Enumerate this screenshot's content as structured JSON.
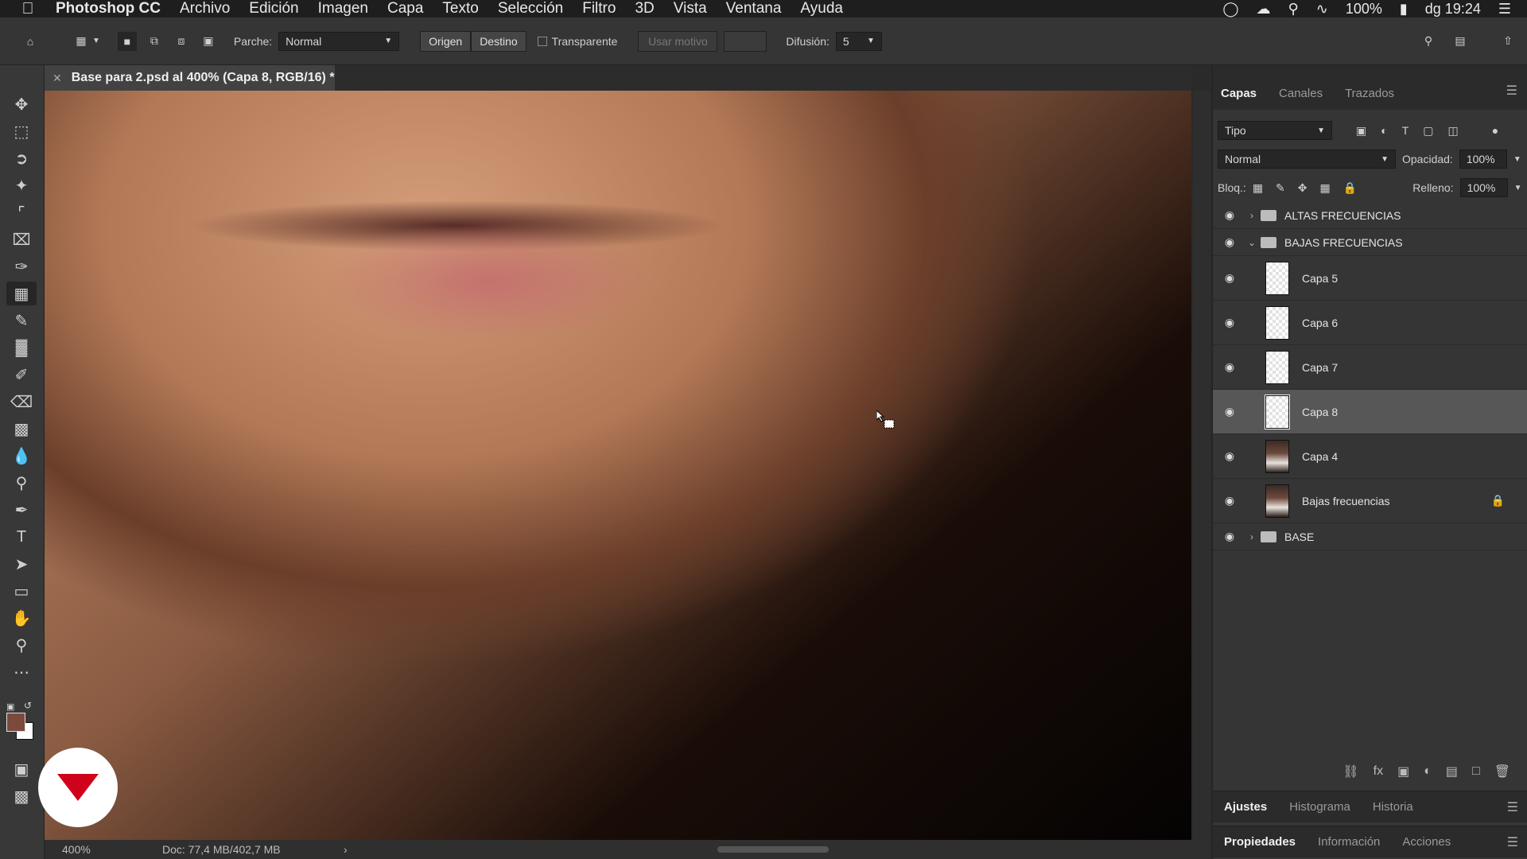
{
  "menubar": {
    "app_name": "Photoshop CC",
    "items": [
      "Archivo",
      "Edición",
      "Imagen",
      "Capa",
      "Texto",
      "Selección",
      "Filtro",
      "3D",
      "Vista",
      "Ventana",
      "Ayuda"
    ],
    "battery": "100%",
    "clock": "dg 19:24"
  },
  "options": {
    "patch_label": "Parche:",
    "patch_mode": "Normal",
    "source_label": "Origen",
    "dest_label": "Destino",
    "transparent_label": "Transparente",
    "use_pattern_label": "Usar motivo",
    "diffusion_label": "Difusión:",
    "diffusion_value": "5"
  },
  "document": {
    "tab_title": "Base para 2.psd al 400% (Capa 8, RGB/16) *"
  },
  "status": {
    "zoom": "400%",
    "doc_size": "Doc: 77,4 MB/402,7 MB"
  },
  "layers_panel": {
    "tabs": [
      "Capas",
      "Canales",
      "Trazados"
    ],
    "filter_kind": "Tipo",
    "blend_mode": "Normal",
    "opacity_label": "Opacidad:",
    "opacity_value": "100%",
    "lock_label": "Bloq.:",
    "fill_label": "Relleno:",
    "fill_value": "100%",
    "layers": [
      {
        "name": "ALTAS FRECUENCIAS",
        "type": "group",
        "expanded": false
      },
      {
        "name": "BAJAS FRECUENCIAS",
        "type": "group",
        "expanded": true
      },
      {
        "name": "Capa 5",
        "type": "layer"
      },
      {
        "name": "Capa 6",
        "type": "layer"
      },
      {
        "name": "Capa 7",
        "type": "layer"
      },
      {
        "name": "Capa 8",
        "type": "layer",
        "selected": true
      },
      {
        "name": "Capa 4",
        "type": "layer"
      },
      {
        "name": "Bajas frecuencias",
        "type": "layer",
        "locked": true
      },
      {
        "name": "BASE",
        "type": "group",
        "expanded": false
      }
    ]
  },
  "bottom_panels": {
    "row1": [
      "Ajustes",
      "Histograma",
      "Historia"
    ],
    "row2": [
      "Propiedades",
      "Información",
      "Acciones"
    ]
  },
  "colors": {
    "foreground": "#7a4a3c",
    "background": "#ffffff",
    "logo_red": "#d0021b"
  }
}
